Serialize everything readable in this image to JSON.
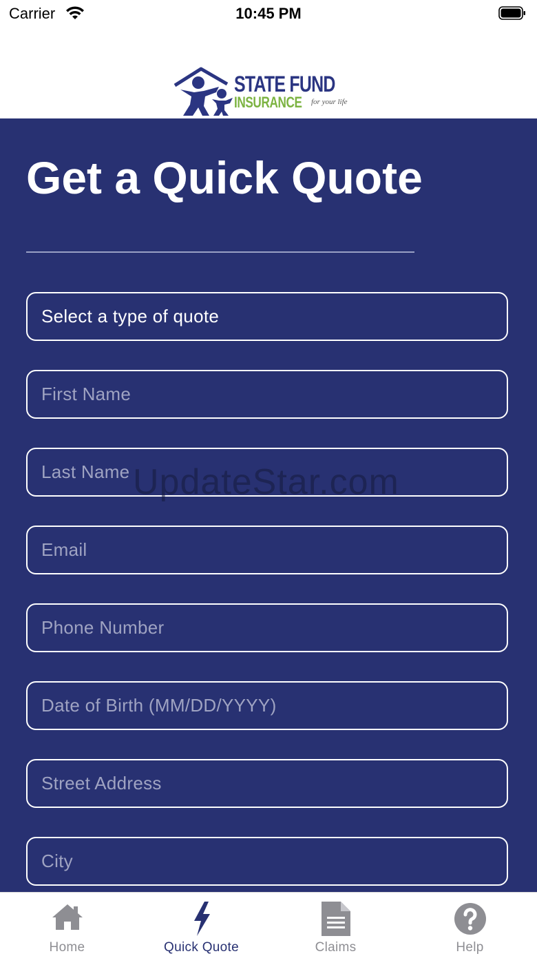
{
  "status_bar": {
    "carrier": "Carrier",
    "time": "10:45 PM"
  },
  "logo": {
    "title": "STATE FUND",
    "subtitle": "INSURANCE",
    "tagline": "for your life"
  },
  "page": {
    "title": "Get a Quick Quote"
  },
  "form": {
    "quote_type": "Select a type of quote",
    "fields": [
      {
        "placeholder": "First Name"
      },
      {
        "placeholder": "Last Name"
      },
      {
        "placeholder": "Email"
      },
      {
        "placeholder": "Phone Number"
      },
      {
        "placeholder": "Date of Birth (MM/DD/YYYY)"
      },
      {
        "placeholder": "Street Address"
      },
      {
        "placeholder": "City"
      }
    ]
  },
  "watermark": "UpdateStar.com",
  "tabbar": {
    "tabs": [
      {
        "label": "Home",
        "icon": "home-icon"
      },
      {
        "label": "Quick Quote",
        "icon": "lightning-bolt-icon",
        "active": true
      },
      {
        "label": "Claims",
        "icon": "document-icon"
      },
      {
        "label": "Help",
        "icon": "help-circle-icon"
      }
    ]
  },
  "colors": {
    "primary_navy": "#283172",
    "brand_green": "#7cb342",
    "inactive_tab": "#8e8e93",
    "placeholder": "#9fa3c2"
  }
}
